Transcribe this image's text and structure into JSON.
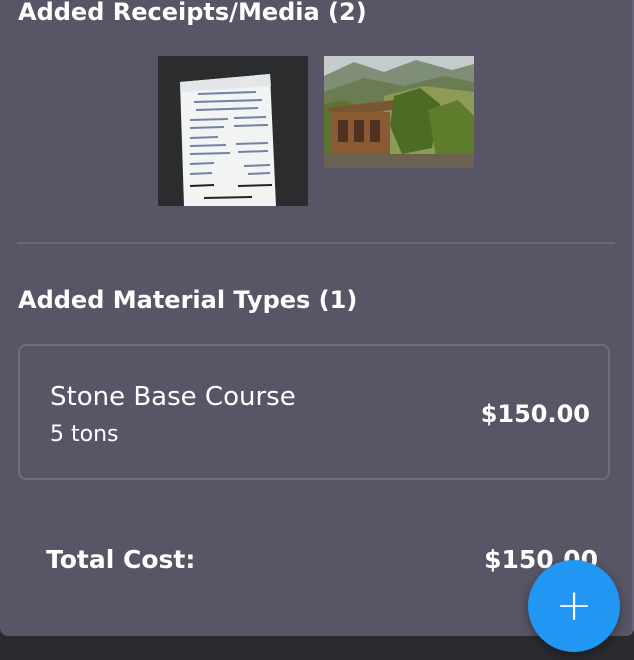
{
  "receipts": {
    "title": "Added Receipts/Media (2)",
    "items": [
      {
        "kind": "receipt-photo",
        "icon": "receipt-image"
      },
      {
        "kind": "cabin-photo",
        "icon": "landscape-image"
      }
    ]
  },
  "materials": {
    "title": "Added Material Types (1)",
    "items": [
      {
        "name": "Stone Base Course",
        "quantity": "5 tons",
        "price": "$150.00"
      }
    ]
  },
  "total": {
    "label": "Total Cost:",
    "value": "$150.00"
  },
  "fab": {
    "icon": "plus-icon",
    "glyph": "+",
    "color": "#2196f3"
  }
}
